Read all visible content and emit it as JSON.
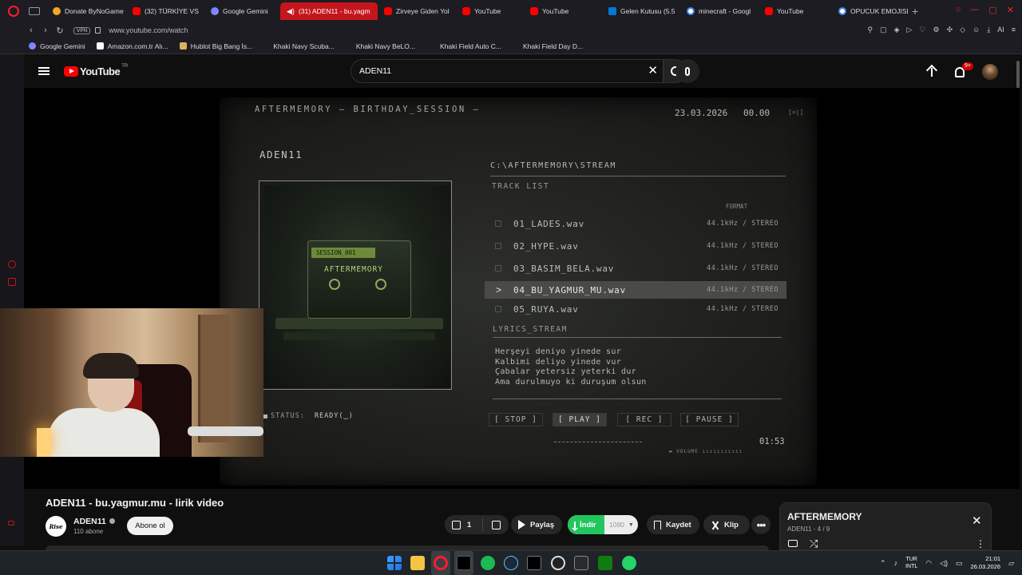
{
  "browser": {
    "tabs": [
      {
        "label": "Donate ByNoGame",
        "icon": "hourglass-icon"
      },
      {
        "label": "(32) TÜRKİYE VS",
        "icon": "youtube-icon"
      },
      {
        "label": "Google Gemini",
        "icon": "gemini-icon"
      },
      {
        "label": "(31) ADEN11 - bu.yagm",
        "icon": "speaker-icon"
      },
      {
        "label": "Zirveye Giden Yol",
        "icon": "youtube-icon"
      },
      {
        "label": "YouTube",
        "icon": "youtube-icon"
      },
      {
        "label": "YouTube",
        "icon": "youtube-icon"
      },
      {
        "label": "Gelen Kutusu (5.5",
        "icon": "mail-icon"
      },
      {
        "label": "minecraft - Googl",
        "icon": "google-icon"
      },
      {
        "label": "YouTube",
        "icon": "youtube-icon"
      },
      {
        "label": "OPUCUK EMOJISI",
        "icon": "google-icon"
      }
    ],
    "vpn_label": "VPN",
    "url": "www.youtube.com/watch",
    "extension_ai_label": "AI",
    "bookmarks": [
      "Google Gemini",
      "Amazon.com.tr Alı...",
      "Hublot Big Bang İs...",
      "Khaki Navy Scuba...",
      "Khaki Navy BeLO...",
      "Khaki Field Auto C...",
      "Khaki Field Day D..."
    ]
  },
  "youtube": {
    "logo_text": "YouTube",
    "country_code": "TR",
    "search_value": "ADEN11",
    "notification_badge": "9+",
    "video_title": "ADEN11 - bu.yagmur.mu - lirik video",
    "channel_avatar_text": "Rise",
    "channel_name": "ADEN11",
    "subscribers": "110 abone",
    "subscribe_label": "Abone ol",
    "like_count": "1",
    "share_label": "Paylaş",
    "download_label": "İndir",
    "download_quality": "1080",
    "save_label": "Kaydet",
    "clip_label": "Klip",
    "playlist_title": "AFTERMEMORY",
    "playlist_sub": "ADEN11 - 4 / 9"
  },
  "video_frame": {
    "header": "AFTERMEMORY — BIRTHDAY_SESSION —",
    "date": "23.03.2026",
    "time": "00.00",
    "corner": "[=|]",
    "artist": "ADEN11",
    "cassette_label": "SESSION_001",
    "cassette_name": "AFTERMEMORY",
    "path": "C:\\AFTERMEMORY\\STREAM",
    "tracklist_title": "TRACK LIST",
    "format_header": "FORMAT",
    "tracks": [
      {
        "name": "01_LADES.wav",
        "format": "44.1kHz / STEREO"
      },
      {
        "name": "02_HYPE.wav",
        "format": "44.1kHz / STEREO"
      },
      {
        "name": "03_BASIM_BELA.wav",
        "format": "44.1kHz / STEREO"
      },
      {
        "name": "04_BU_YAGMUR_MU.wav",
        "format": "44.1kHz / STEREO"
      },
      {
        "name": "05_RUYA.wav",
        "format": "44.1kHz / STEREO"
      }
    ],
    "selected_track_index": 3,
    "lyrics_title": "LYRICS_STREAM",
    "lyrics": [
      "Herşeyi deniyo yinede sur",
      "Kalbimi deliyo yinede vur",
      "Çabalar yetersiz yeterki dur",
      "Ama durulmuyo ki duruşum olsun"
    ],
    "status_label": "STATUS:",
    "status_value": "READY(‿)",
    "controls": [
      "[ STOP ]",
      "[ PLAY ]",
      "[ REC ]",
      "[ PAUSE ]"
    ],
    "timer": "01:53",
    "volume_label": "VOLUME"
  },
  "taskbar": {
    "lang_top": "TUR",
    "lang_bottom": "INTL",
    "time": "21:01",
    "date": "26.03.2026"
  },
  "colors": {
    "browser_accent": "#c4161c",
    "youtube_red": "#ff0000",
    "download_green": "#22c55e"
  }
}
